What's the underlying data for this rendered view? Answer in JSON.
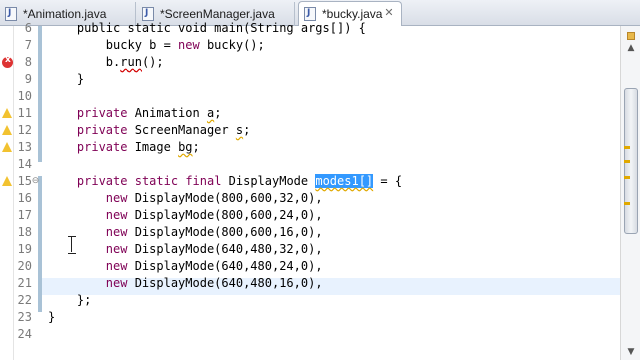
{
  "tabs": [
    {
      "label": "*Animation.java",
      "active": false
    },
    {
      "label": "*ScreenManager.java",
      "active": false
    },
    {
      "label": "*bucky.java",
      "active": true
    }
  ],
  "tab_close_glyph": "✕",
  "lines": [
    {
      "num": "6",
      "segments": [
        {
          "t": "    public static void main(String args[]) {",
          "c": "plain"
        }
      ],
      "marker": "none",
      "fold": ""
    },
    {
      "num": "7",
      "segments": [
        {
          "t": "        bucky b = ",
          "c": "plain"
        },
        {
          "t": "new",
          "c": "kw"
        },
        {
          "t": " bucky();",
          "c": "plain"
        }
      ],
      "marker": "none",
      "fold": ""
    },
    {
      "num": "8",
      "segments": [
        {
          "t": "        b.",
          "c": "plain"
        },
        {
          "t": "run",
          "c": "err"
        },
        {
          "t": "();",
          "c": "plain"
        }
      ],
      "marker": "error",
      "fold": ""
    },
    {
      "num": "9",
      "segments": [
        {
          "t": "    }",
          "c": "plain"
        }
      ],
      "marker": "none",
      "fold": ""
    },
    {
      "num": "10",
      "segments": [
        {
          "t": "",
          "c": "plain"
        }
      ],
      "marker": "none",
      "fold": ""
    },
    {
      "num": "11",
      "segments": [
        {
          "t": "    ",
          "c": "plain"
        },
        {
          "t": "private",
          "c": "kw"
        },
        {
          "t": " Animation ",
          "c": "plain"
        },
        {
          "t": "a",
          "c": "warn"
        },
        {
          "t": ";",
          "c": "plain"
        }
      ],
      "marker": "warning",
      "fold": ""
    },
    {
      "num": "12",
      "segments": [
        {
          "t": "    ",
          "c": "plain"
        },
        {
          "t": "private",
          "c": "kw"
        },
        {
          "t": " ScreenManager ",
          "c": "plain"
        },
        {
          "t": "s",
          "c": "warn"
        },
        {
          "t": ";",
          "c": "plain"
        }
      ],
      "marker": "warning",
      "fold": ""
    },
    {
      "num": "13",
      "segments": [
        {
          "t": "    ",
          "c": "plain"
        },
        {
          "t": "private",
          "c": "kw"
        },
        {
          "t": " Image ",
          "c": "plain"
        },
        {
          "t": "bg",
          "c": "warn"
        },
        {
          "t": ";",
          "c": "plain"
        }
      ],
      "marker": "warning",
      "fold": ""
    },
    {
      "num": "14",
      "segments": [
        {
          "t": "",
          "c": "plain"
        }
      ],
      "marker": "none",
      "fold": ""
    },
    {
      "num": "15",
      "segments": [
        {
          "t": "    ",
          "c": "plain"
        },
        {
          "t": "private",
          "c": "kw"
        },
        {
          "t": " ",
          "c": "plain"
        },
        {
          "t": "static",
          "c": "kw"
        },
        {
          "t": " ",
          "c": "plain"
        },
        {
          "t": "final",
          "c": "kw"
        },
        {
          "t": " DisplayMode ",
          "c": "plain"
        },
        {
          "t": "modes1[]",
          "c": "sel"
        },
        {
          "t": " = {",
          "c": "plain"
        }
      ],
      "marker": "warning",
      "fold": "⊖"
    },
    {
      "num": "16",
      "segments": [
        {
          "t": "        ",
          "c": "plain"
        },
        {
          "t": "new",
          "c": "kw"
        },
        {
          "t": " DisplayMode(800,600,32,0),",
          "c": "plain"
        }
      ],
      "marker": "none",
      "fold": ""
    },
    {
      "num": "17",
      "segments": [
        {
          "t": "        ",
          "c": "plain"
        },
        {
          "t": "new",
          "c": "kw"
        },
        {
          "t": " DisplayMode(800,600,24,0),",
          "c": "plain"
        }
      ],
      "marker": "none",
      "fold": ""
    },
    {
      "num": "18",
      "segments": [
        {
          "t": "        ",
          "c": "plain"
        },
        {
          "t": "new",
          "c": "kw"
        },
        {
          "t": " DisplayMode(800,600,16,0),",
          "c": "plain"
        }
      ],
      "marker": "none",
      "fold": ""
    },
    {
      "num": "19",
      "segments": [
        {
          "t": "        ",
          "c": "plain"
        },
        {
          "t": "new",
          "c": "kw"
        },
        {
          "t": " DisplayMode(640,480,32,0),",
          "c": "plain"
        }
      ],
      "marker": "none",
      "fold": ""
    },
    {
      "num": "20",
      "segments": [
        {
          "t": "        ",
          "c": "plain"
        },
        {
          "t": "new",
          "c": "kw"
        },
        {
          "t": " DisplayMode(640,480,24,0),",
          "c": "plain"
        }
      ],
      "marker": "none",
      "fold": ""
    },
    {
      "num": "21",
      "segments": [
        {
          "t": "        ",
          "c": "plain"
        },
        {
          "t": "new",
          "c": "kw"
        },
        {
          "t": " DisplayMode(640,480,16,0),",
          "c": "plain"
        }
      ],
      "marker": "none",
      "fold": ""
    },
    {
      "num": "22",
      "segments": [
        {
          "t": "    };",
          "c": "plain"
        }
      ],
      "marker": "none",
      "fold": ""
    },
    {
      "num": "23",
      "segments": [
        {
          "t": "}",
          "c": "plain"
        }
      ],
      "marker": "none",
      "fold": ""
    },
    {
      "num": "24",
      "segments": [
        {
          "t": "",
          "c": "plain"
        }
      ],
      "marker": "none",
      "fold": ""
    }
  ],
  "colors": {
    "keyword": "#7f0055",
    "selection": "#3399ff",
    "warning": "#e0a800",
    "error": "#d20000",
    "line_number": "#7a7a7a"
  },
  "icons": {
    "tab": "java-file-icon",
    "warning": "warning-icon",
    "error": "error-icon",
    "fold": "fold-collapse-icon"
  }
}
